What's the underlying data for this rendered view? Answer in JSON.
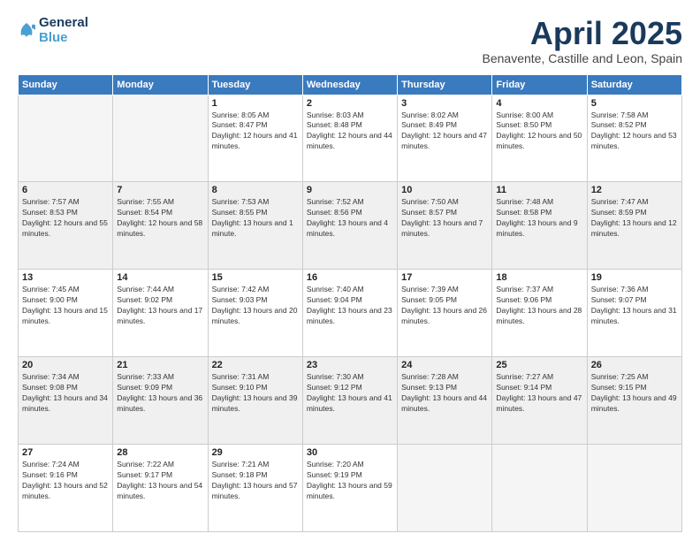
{
  "header": {
    "logo_line1": "General",
    "logo_line2": "Blue",
    "month_year": "April 2025",
    "location": "Benavente, Castille and Leon, Spain"
  },
  "days_of_week": [
    "Sunday",
    "Monday",
    "Tuesday",
    "Wednesday",
    "Thursday",
    "Friday",
    "Saturday"
  ],
  "weeks": [
    [
      {
        "day": "",
        "empty": true
      },
      {
        "day": "",
        "empty": true
      },
      {
        "day": "1",
        "sunrise": "Sunrise: 8:05 AM",
        "sunset": "Sunset: 8:47 PM",
        "daylight": "Daylight: 12 hours and 41 minutes."
      },
      {
        "day": "2",
        "sunrise": "Sunrise: 8:03 AM",
        "sunset": "Sunset: 8:48 PM",
        "daylight": "Daylight: 12 hours and 44 minutes."
      },
      {
        "day": "3",
        "sunrise": "Sunrise: 8:02 AM",
        "sunset": "Sunset: 8:49 PM",
        "daylight": "Daylight: 12 hours and 47 minutes."
      },
      {
        "day": "4",
        "sunrise": "Sunrise: 8:00 AM",
        "sunset": "Sunset: 8:50 PM",
        "daylight": "Daylight: 12 hours and 50 minutes."
      },
      {
        "day": "5",
        "sunrise": "Sunrise: 7:58 AM",
        "sunset": "Sunset: 8:52 PM",
        "daylight": "Daylight: 12 hours and 53 minutes."
      }
    ],
    [
      {
        "day": "6",
        "sunrise": "Sunrise: 7:57 AM",
        "sunset": "Sunset: 8:53 PM",
        "daylight": "Daylight: 12 hours and 55 minutes."
      },
      {
        "day": "7",
        "sunrise": "Sunrise: 7:55 AM",
        "sunset": "Sunset: 8:54 PM",
        "daylight": "Daylight: 12 hours and 58 minutes."
      },
      {
        "day": "8",
        "sunrise": "Sunrise: 7:53 AM",
        "sunset": "Sunset: 8:55 PM",
        "daylight": "Daylight: 13 hours and 1 minute."
      },
      {
        "day": "9",
        "sunrise": "Sunrise: 7:52 AM",
        "sunset": "Sunset: 8:56 PM",
        "daylight": "Daylight: 13 hours and 4 minutes."
      },
      {
        "day": "10",
        "sunrise": "Sunrise: 7:50 AM",
        "sunset": "Sunset: 8:57 PM",
        "daylight": "Daylight: 13 hours and 7 minutes."
      },
      {
        "day": "11",
        "sunrise": "Sunrise: 7:48 AM",
        "sunset": "Sunset: 8:58 PM",
        "daylight": "Daylight: 13 hours and 9 minutes."
      },
      {
        "day": "12",
        "sunrise": "Sunrise: 7:47 AM",
        "sunset": "Sunset: 8:59 PM",
        "daylight": "Daylight: 13 hours and 12 minutes."
      }
    ],
    [
      {
        "day": "13",
        "sunrise": "Sunrise: 7:45 AM",
        "sunset": "Sunset: 9:00 PM",
        "daylight": "Daylight: 13 hours and 15 minutes."
      },
      {
        "day": "14",
        "sunrise": "Sunrise: 7:44 AM",
        "sunset": "Sunset: 9:02 PM",
        "daylight": "Daylight: 13 hours and 17 minutes."
      },
      {
        "day": "15",
        "sunrise": "Sunrise: 7:42 AM",
        "sunset": "Sunset: 9:03 PM",
        "daylight": "Daylight: 13 hours and 20 minutes."
      },
      {
        "day": "16",
        "sunrise": "Sunrise: 7:40 AM",
        "sunset": "Sunset: 9:04 PM",
        "daylight": "Daylight: 13 hours and 23 minutes."
      },
      {
        "day": "17",
        "sunrise": "Sunrise: 7:39 AM",
        "sunset": "Sunset: 9:05 PM",
        "daylight": "Daylight: 13 hours and 26 minutes."
      },
      {
        "day": "18",
        "sunrise": "Sunrise: 7:37 AM",
        "sunset": "Sunset: 9:06 PM",
        "daylight": "Daylight: 13 hours and 28 minutes."
      },
      {
        "day": "19",
        "sunrise": "Sunrise: 7:36 AM",
        "sunset": "Sunset: 9:07 PM",
        "daylight": "Daylight: 13 hours and 31 minutes."
      }
    ],
    [
      {
        "day": "20",
        "sunrise": "Sunrise: 7:34 AM",
        "sunset": "Sunset: 9:08 PM",
        "daylight": "Daylight: 13 hours and 34 minutes."
      },
      {
        "day": "21",
        "sunrise": "Sunrise: 7:33 AM",
        "sunset": "Sunset: 9:09 PM",
        "daylight": "Daylight: 13 hours and 36 minutes."
      },
      {
        "day": "22",
        "sunrise": "Sunrise: 7:31 AM",
        "sunset": "Sunset: 9:10 PM",
        "daylight": "Daylight: 13 hours and 39 minutes."
      },
      {
        "day": "23",
        "sunrise": "Sunrise: 7:30 AM",
        "sunset": "Sunset: 9:12 PM",
        "daylight": "Daylight: 13 hours and 41 minutes."
      },
      {
        "day": "24",
        "sunrise": "Sunrise: 7:28 AM",
        "sunset": "Sunset: 9:13 PM",
        "daylight": "Daylight: 13 hours and 44 minutes."
      },
      {
        "day": "25",
        "sunrise": "Sunrise: 7:27 AM",
        "sunset": "Sunset: 9:14 PM",
        "daylight": "Daylight: 13 hours and 47 minutes."
      },
      {
        "day": "26",
        "sunrise": "Sunrise: 7:25 AM",
        "sunset": "Sunset: 9:15 PM",
        "daylight": "Daylight: 13 hours and 49 minutes."
      }
    ],
    [
      {
        "day": "27",
        "sunrise": "Sunrise: 7:24 AM",
        "sunset": "Sunset: 9:16 PM",
        "daylight": "Daylight: 13 hours and 52 minutes."
      },
      {
        "day": "28",
        "sunrise": "Sunrise: 7:22 AM",
        "sunset": "Sunset: 9:17 PM",
        "daylight": "Daylight: 13 hours and 54 minutes."
      },
      {
        "day": "29",
        "sunrise": "Sunrise: 7:21 AM",
        "sunset": "Sunset: 9:18 PM",
        "daylight": "Daylight: 13 hours and 57 minutes."
      },
      {
        "day": "30",
        "sunrise": "Sunrise: 7:20 AM",
        "sunset": "Sunset: 9:19 PM",
        "daylight": "Daylight: 13 hours and 59 minutes."
      },
      {
        "day": "",
        "empty": true
      },
      {
        "day": "",
        "empty": true
      },
      {
        "day": "",
        "empty": true
      }
    ]
  ]
}
